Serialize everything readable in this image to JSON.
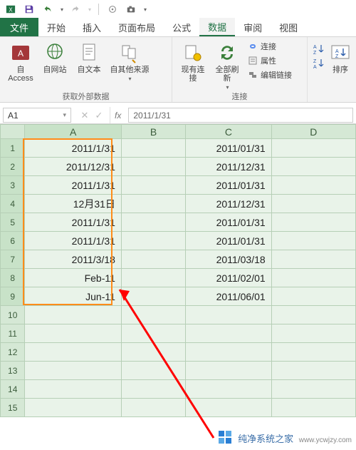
{
  "qat": {
    "excel_icon": "XL"
  },
  "tabs": {
    "file": "文件",
    "items": [
      "开始",
      "插入",
      "页面布局",
      "公式",
      "数据",
      "审阅",
      "视图"
    ],
    "active_index": 4
  },
  "ribbon": {
    "group_external": {
      "label": "获取外部数据",
      "access": "自 Access",
      "web": "自网站",
      "text": "自文本",
      "other": "自其他来源"
    },
    "group_connections": {
      "label": "连接",
      "existing": "现有连接",
      "refresh": "全部刷新",
      "conn": "连接",
      "props": "属性",
      "editlinks": "编辑链接"
    },
    "group_sort": {
      "sort": "排序"
    }
  },
  "namebox": "A1",
  "formula_value": "2011/1/31",
  "columns": [
    "A",
    "B",
    "C",
    "D"
  ],
  "rows": [
    {
      "n": 1,
      "A": "2011/1/31",
      "B": "",
      "C": "2011/01/31",
      "D": ""
    },
    {
      "n": 2,
      "A": "2011/12/31",
      "B": "",
      "C": "2011/12/31",
      "D": ""
    },
    {
      "n": 3,
      "A": "2011/1/31",
      "B": "",
      "C": "2011/01/31",
      "D": ""
    },
    {
      "n": 4,
      "A": "12月31日",
      "B": "",
      "C": "2011/12/31",
      "D": ""
    },
    {
      "n": 5,
      "A": "2011/1/31",
      "B": "",
      "C": "2011/01/31",
      "D": ""
    },
    {
      "n": 6,
      "A": "2011/1/31",
      "B": "",
      "C": "2011/01/31",
      "D": ""
    },
    {
      "n": 7,
      "A": "2011/3/18",
      "B": "",
      "C": "2011/03/18",
      "D": ""
    },
    {
      "n": 8,
      "A": "Feb-11",
      "B": "",
      "C": "2011/02/01",
      "D": ""
    },
    {
      "n": 9,
      "A": "Jun-11",
      "B": "",
      "C": "2011/06/01",
      "D": ""
    },
    {
      "n": 10,
      "A": "",
      "B": "",
      "C": "",
      "D": ""
    },
    {
      "n": 11,
      "A": "",
      "B": "",
      "C": "",
      "D": ""
    },
    {
      "n": 12,
      "A": "",
      "B": "",
      "C": "",
      "D": ""
    },
    {
      "n": 13,
      "A": "",
      "B": "",
      "C": "",
      "D": ""
    },
    {
      "n": 14,
      "A": "",
      "B": "",
      "C": "",
      "D": ""
    },
    {
      "n": 15,
      "A": "",
      "B": "",
      "C": "",
      "D": ""
    }
  ],
  "watermark": {
    "text": "纯净系统之家",
    "url": "www.ycwjzy.com"
  },
  "colors": {
    "accent": "#217346",
    "selection_border": "#ff8c1a",
    "arrow": "#ff0000",
    "grid_header": "#d5e8d5",
    "grid_cell": "#e9f3e9"
  }
}
